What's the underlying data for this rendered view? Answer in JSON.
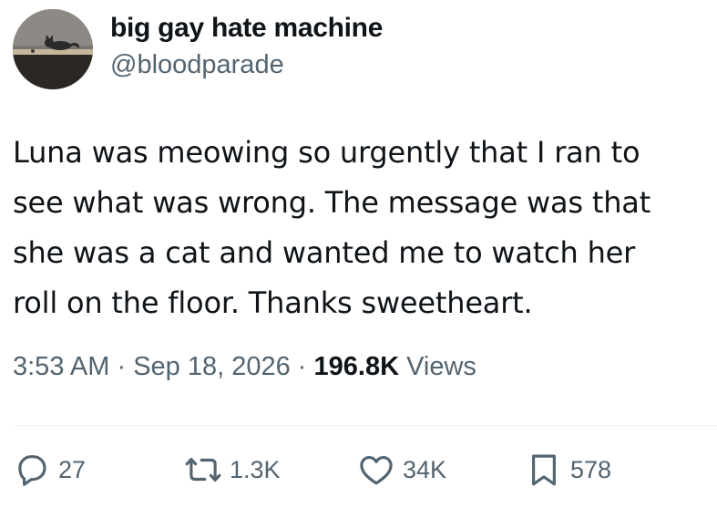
{
  "author": {
    "display_name": "big gay hate machine",
    "handle": "@bloodparade",
    "avatar_icon": "cat-on-shelf-photo"
  },
  "tweet": {
    "text": "Luna was meowing so urgently that I ran to\nsee what was wrong. The message was that\nshe was a cat and wanted me to watch her\nroll on the floor. Thanks sweetheart."
  },
  "meta": {
    "time": "3:53 AM",
    "separator": " · ",
    "date": "Sep 18, 2026",
    "views_count": "196.8K",
    "views_label": " Views"
  },
  "actions": {
    "replies": "27",
    "retweets": "1.3K",
    "likes": "34K",
    "bookmarks": "578"
  },
  "colors": {
    "text": "#0f1419",
    "secondary": "#536471",
    "divider": "#eff3f4"
  }
}
